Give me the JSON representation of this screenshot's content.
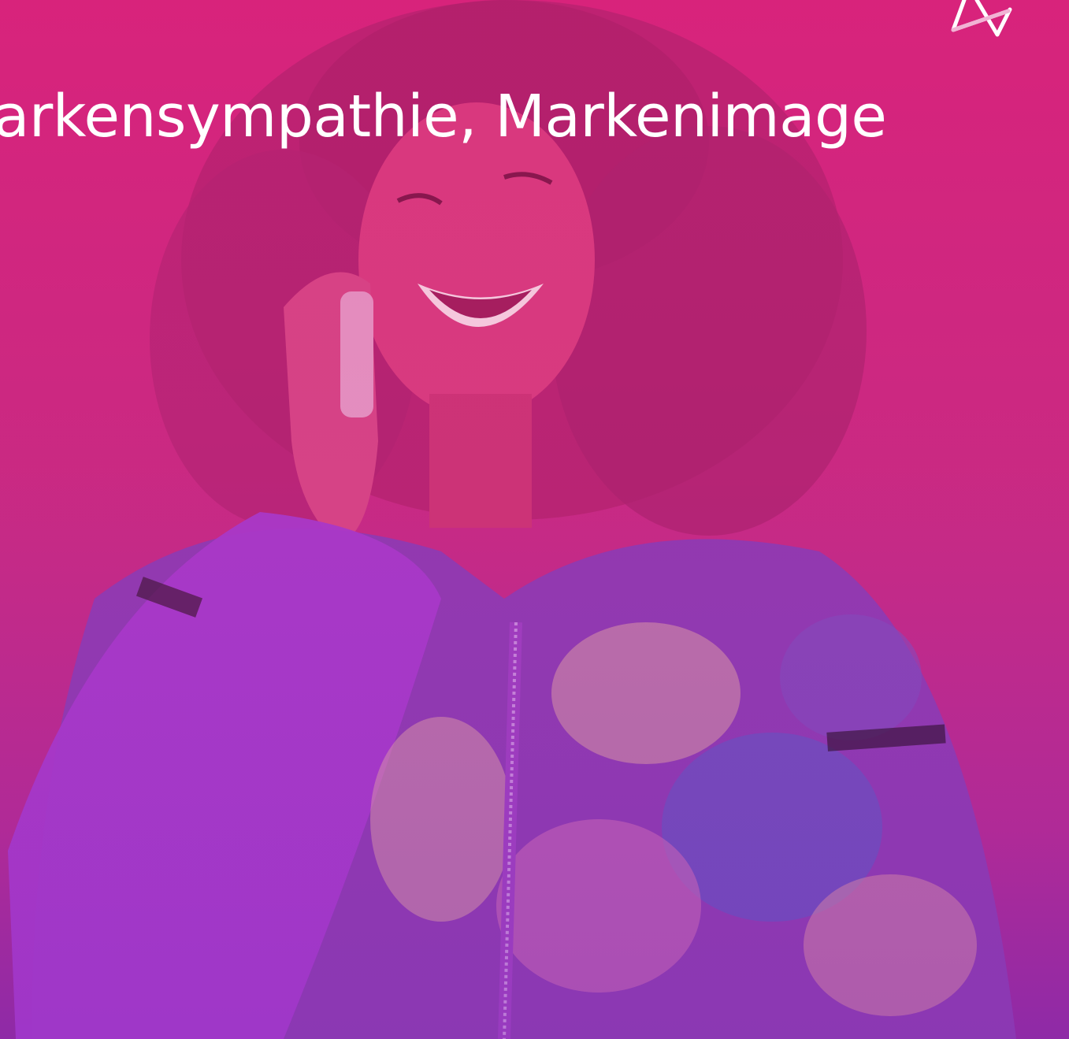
{
  "hero": {
    "headline": "arkensympathie, Markenimage",
    "overlay_color": "#d7247c",
    "overlay_color_bottom": "#8f2aa6"
  },
  "logo": {
    "icon": "triangle-logo-icon",
    "color": "#ffffff"
  }
}
